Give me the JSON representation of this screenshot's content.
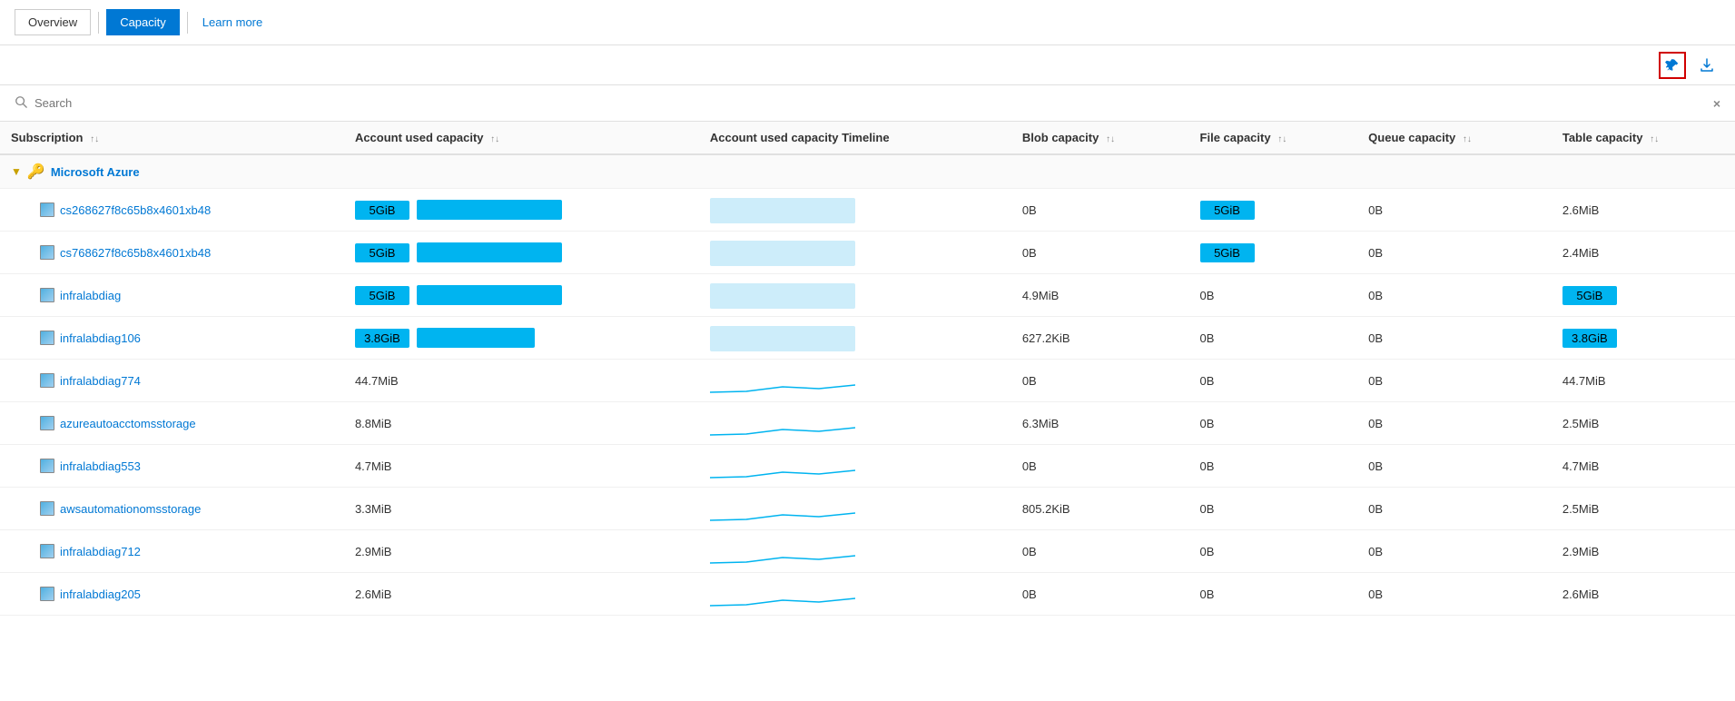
{
  "nav": {
    "overview_label": "Overview",
    "capacity_label": "Capacity",
    "learn_more_label": "Learn more"
  },
  "toolbar": {
    "pin_title": "Pin to dashboard",
    "download_title": "Download"
  },
  "search": {
    "placeholder": "Search",
    "clear_label": "×"
  },
  "table": {
    "columns": [
      {
        "key": "subscription",
        "label": "Subscription"
      },
      {
        "key": "account_used_capacity",
        "label": "Account used capacity"
      },
      {
        "key": "account_used_capacity_timeline",
        "label": "Account used capacity Timeline"
      },
      {
        "key": "blob_capacity",
        "label": "Blob capacity"
      },
      {
        "key": "file_capacity",
        "label": "File capacity"
      },
      {
        "key": "queue_capacity",
        "label": "Queue capacity"
      },
      {
        "key": "table_capacity",
        "label": "Table capacity"
      }
    ],
    "groups": [
      {
        "name": "Microsoft Azure",
        "rows": [
          {
            "name": "cs268627f8c65b8x4601xb48",
            "account_used_capacity": "5GiB",
            "account_used_capacity_bar": true,
            "account_used_capacity_highlight": true,
            "timeline_type": "block",
            "blob_capacity": "0B",
            "blob_capacity_highlight": false,
            "file_capacity": "5GiB",
            "file_capacity_highlight": true,
            "queue_capacity": "0B",
            "table_capacity": "2.6MiB"
          },
          {
            "name": "cs768627f8c65b8x4601xb48",
            "account_used_capacity": "5GiB",
            "account_used_capacity_bar": true,
            "account_used_capacity_highlight": true,
            "timeline_type": "block",
            "blob_capacity": "0B",
            "blob_capacity_highlight": false,
            "file_capacity": "5GiB",
            "file_capacity_highlight": true,
            "queue_capacity": "0B",
            "table_capacity": "2.4MiB"
          },
          {
            "name": "infralabdiag",
            "account_used_capacity": "5GiB",
            "account_used_capacity_bar": true,
            "account_used_capacity_highlight": true,
            "timeline_type": "block",
            "blob_capacity": "4.9MiB",
            "blob_capacity_highlight": false,
            "file_capacity": "0B",
            "file_capacity_highlight": false,
            "queue_capacity": "0B",
            "table_capacity": "5GiB",
            "table_capacity_highlight": true
          },
          {
            "name": "infralabdiag106",
            "account_used_capacity": "3.8GiB",
            "account_used_capacity_bar": true,
            "account_used_capacity_highlight": true,
            "timeline_type": "block",
            "blob_capacity": "627.2KiB",
            "blob_capacity_highlight": false,
            "file_capacity": "0B",
            "file_capacity_highlight": false,
            "queue_capacity": "0B",
            "table_capacity": "3.8GiB",
            "table_capacity_highlight": true
          },
          {
            "name": "infralabdiag774",
            "account_used_capacity": "44.7MiB",
            "account_used_capacity_bar": false,
            "timeline_type": "line",
            "blob_capacity": "0B",
            "file_capacity": "0B",
            "queue_capacity": "0B",
            "table_capacity": "44.7MiB"
          },
          {
            "name": "azureautoacctomsstorage",
            "account_used_capacity": "8.8MiB",
            "account_used_capacity_bar": false,
            "timeline_type": "line",
            "blob_capacity": "6.3MiB",
            "file_capacity": "0B",
            "queue_capacity": "0B",
            "table_capacity": "2.5MiB"
          },
          {
            "name": "infralabdiag553",
            "account_used_capacity": "4.7MiB",
            "account_used_capacity_bar": false,
            "timeline_type": "line",
            "blob_capacity": "0B",
            "file_capacity": "0B",
            "queue_capacity": "0B",
            "table_capacity": "4.7MiB"
          },
          {
            "name": "awsautomationomsstorage",
            "account_used_capacity": "3.3MiB",
            "account_used_capacity_bar": false,
            "timeline_type": "line",
            "blob_capacity": "805.2KiB",
            "file_capacity": "0B",
            "queue_capacity": "0B",
            "table_capacity": "2.5MiB"
          },
          {
            "name": "infralabdiag712",
            "account_used_capacity": "2.9MiB",
            "account_used_capacity_bar": false,
            "timeline_type": "line",
            "blob_capacity": "0B",
            "file_capacity": "0B",
            "queue_capacity": "0B",
            "table_capacity": "2.9MiB"
          },
          {
            "name": "infralabdiag205",
            "account_used_capacity": "2.6MiB",
            "account_used_capacity_bar": false,
            "timeline_type": "line",
            "blob_capacity": "0B",
            "file_capacity": "0B",
            "queue_capacity": "0B",
            "table_capacity": "2.6MiB"
          }
        ]
      }
    ]
  },
  "colors": {
    "accent": "#0078d4",
    "bar_blue": "#00b4f0",
    "bar_highlight": "#00b4f0"
  }
}
